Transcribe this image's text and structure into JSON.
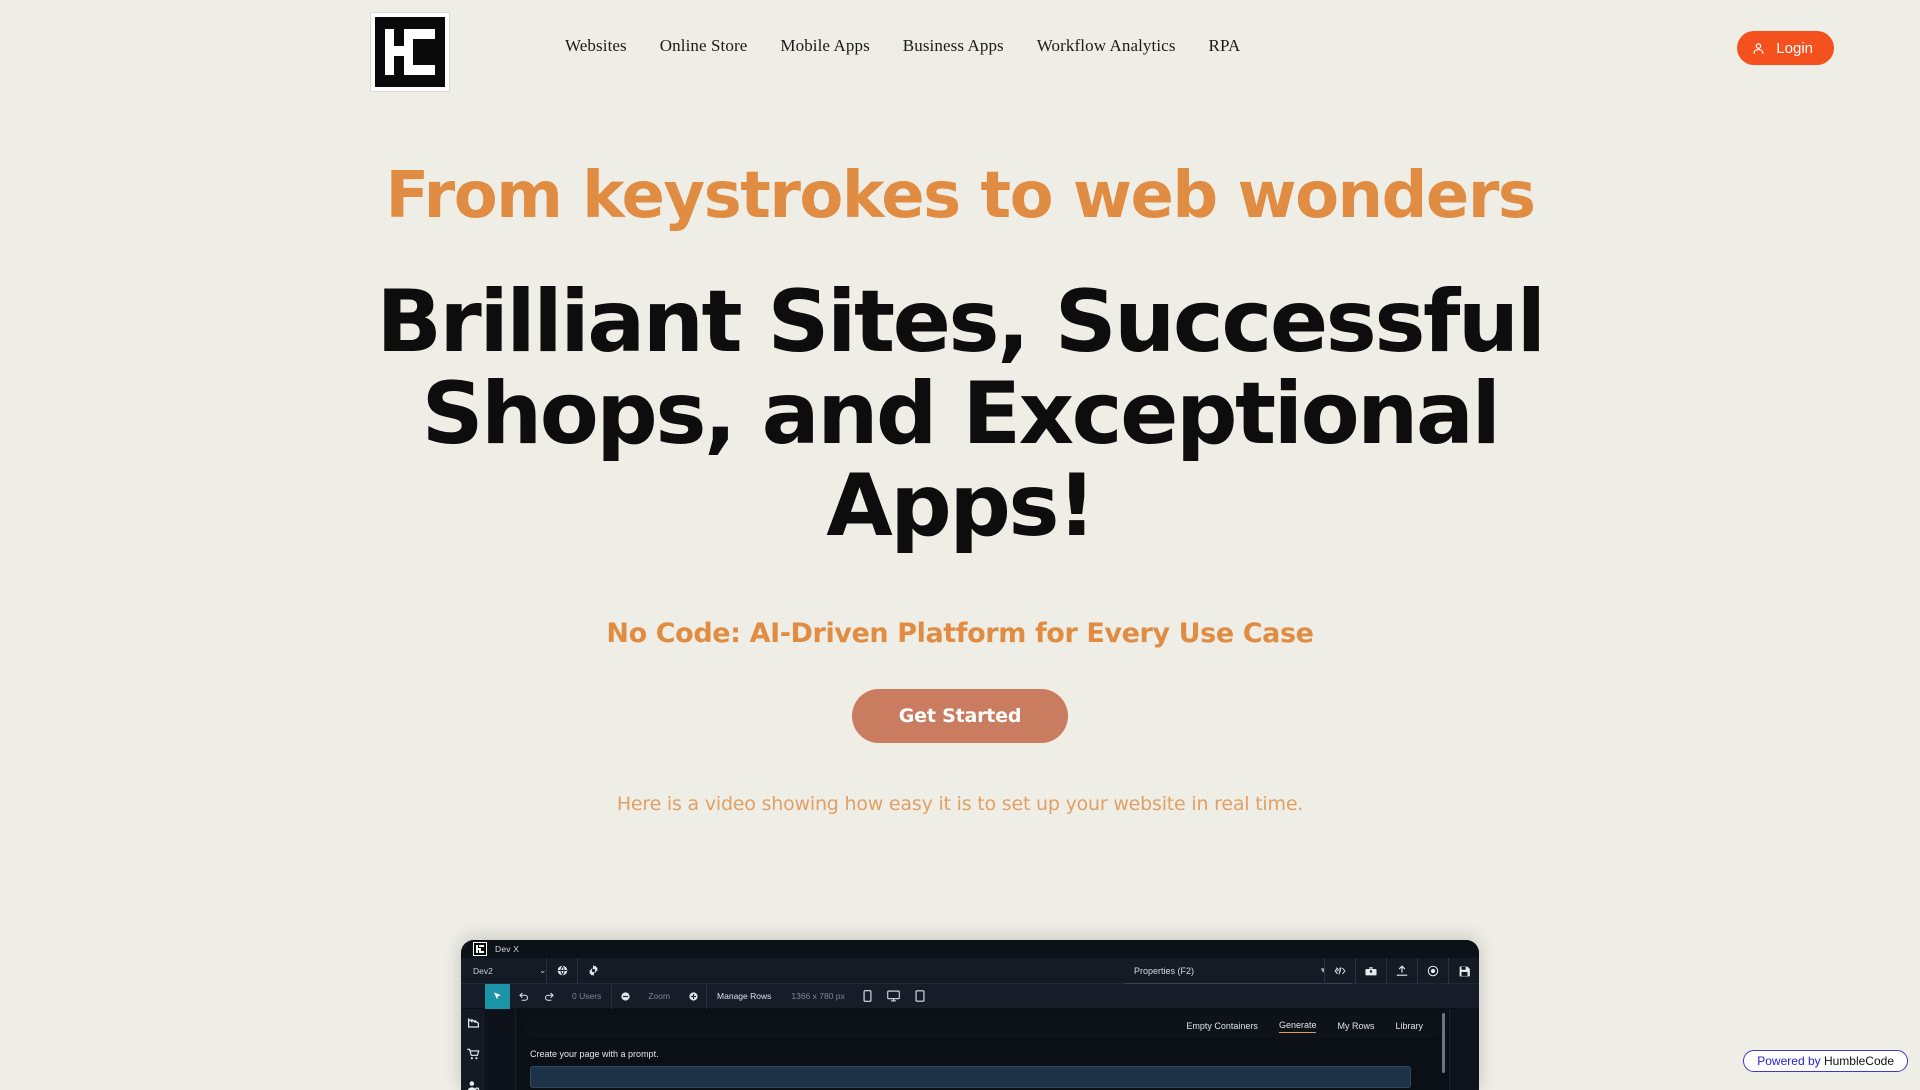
{
  "theme": {
    "background": "#eeeee6",
    "accent_orange": "#e08c43",
    "login_orange": "#f4511e",
    "cta_terracotta": "#c97c5f",
    "heading_black": "#0d0d0d",
    "badge_blue": "#2222cc"
  },
  "header": {
    "logo_alt": "HumbleCode HC logo",
    "nav": [
      {
        "label": "Websites"
      },
      {
        "label": "Online Store"
      },
      {
        "label": "Mobile Apps"
      },
      {
        "label": "Business Apps"
      },
      {
        "label": "Workflow Analytics"
      },
      {
        "label": "RPA"
      }
    ],
    "login": {
      "label": "Login",
      "icon": "user-icon"
    }
  },
  "hero": {
    "eyebrow": "From keystrokes to web wonders",
    "headline": "Brilliant Sites, Successful Shops, and Exceptional Apps!",
    "subheadline": "No Code: AI-Driven Platform for Every Use Case",
    "cta_label": "Get Started",
    "video_caption": "Here is a video showing how easy it is to set up your website in real time."
  },
  "app_preview": {
    "titlebar": {
      "app_name": "Dev X"
    },
    "toolbar": {
      "project_name": "Dev2",
      "chevron": "⌄",
      "globe_icon": "globe-icon",
      "settings_icon": "gear-icon"
    },
    "properties_panel": {
      "title": "Properties (F2)",
      "dropdown_icon": "chevron-down-icon",
      "close_icon": "close-icon"
    },
    "right_icons": [
      {
        "name": "code-icon",
        "glyph": "</>"
      },
      {
        "name": "toolbox-icon",
        "glyph": "⚒"
      },
      {
        "name": "upload-icon",
        "glyph": "⇧"
      },
      {
        "name": "preview-eye-icon",
        "glyph": "◎"
      },
      {
        "name": "save-icon",
        "glyph": "Ὃe"
      }
    ],
    "toolbar2": {
      "pointer_tool": "pointer-tool",
      "undo_icon": "undo-icon",
      "redo_icon": "redo-icon",
      "users_label": "0 Users",
      "zoom_out_icon": "zoom-out-icon",
      "zoom_label": "Zoom",
      "zoom_in_icon": "zoom-in-icon",
      "manage_rows_label": "Manage Rows",
      "canvas_size_label": "1366 x 780 px",
      "device_phone": "phone-icon",
      "device_desktop": "desktop-icon",
      "device_tablet": "tablet-icon"
    },
    "rail_icons": [
      {
        "name": "analytics-icon"
      },
      {
        "name": "shopping-cart-icon"
      },
      {
        "name": "user-settings-icon"
      }
    ],
    "tabs": [
      {
        "label": "Empty Containers",
        "active": false
      },
      {
        "label": "Generate",
        "active": true
      },
      {
        "label": "My Rows",
        "active": false
      },
      {
        "label": "Library",
        "active": false
      }
    ],
    "close_x": "✕",
    "prompt_label": "Create your page with a prompt."
  },
  "powered_badge": {
    "prefix": "Powered by ",
    "brand": "HumbleCode"
  }
}
